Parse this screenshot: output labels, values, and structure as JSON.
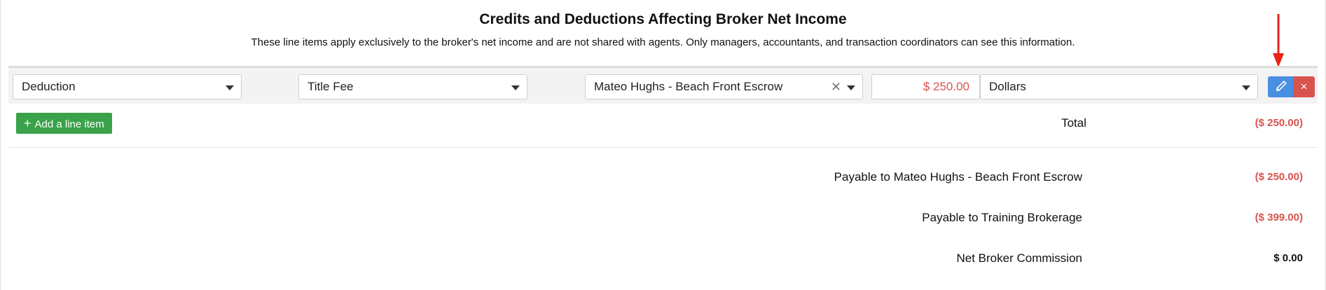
{
  "header": {
    "title": "Credits and Deductions Affecting Broker Net Income",
    "subtitle": "These line items apply exclusively to the broker's net income and are not shared with agents. Only managers, accountants, and transaction coordinators can see this information."
  },
  "line_item": {
    "type": "Deduction",
    "category": "Title Fee",
    "payee": "Mateo Hughs - Beach Front Escrow",
    "amount": "$ 250.00",
    "unit": "Dollars",
    "delete_symbol": "×"
  },
  "actions": {
    "add_label": "Add a line item"
  },
  "total": {
    "label": "Total",
    "value": "($ 250.00)"
  },
  "summary": [
    {
      "label": "Payable to Mateo Hughs - Beach Front Escrow",
      "value": "($ 250.00)"
    },
    {
      "label": "Payable to Training Brokerage",
      "value": "($ 399.00)"
    },
    {
      "label": "Net Broker Commission",
      "value": "$ 0.00"
    }
  ],
  "colors": {
    "accent_blue": "#4a90e2",
    "danger_red": "#d9534f",
    "success_green": "#3aa24a",
    "annotation_arrow": "#e8231a"
  }
}
